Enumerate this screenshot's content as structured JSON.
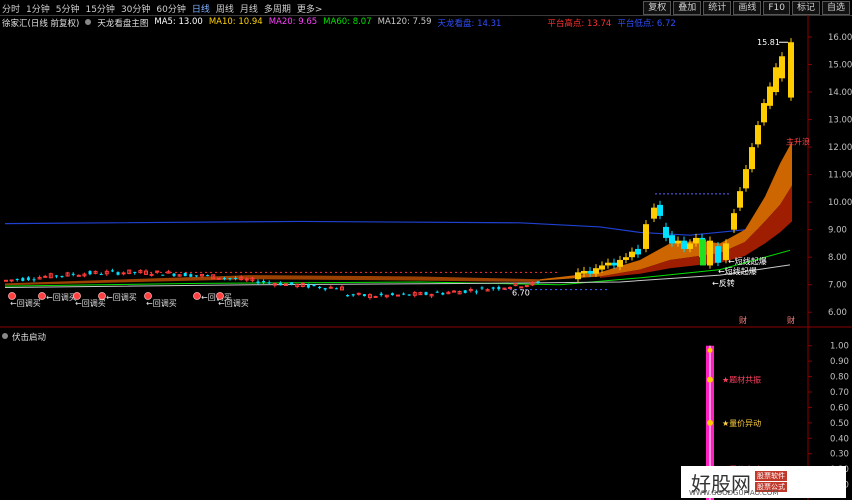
{
  "toolbar": {
    "periods": [
      "分时",
      "1分钟",
      "5分钟",
      "15分钟",
      "30分钟",
      "60分钟",
      "日线",
      "周线",
      "月线",
      "多周期",
      "更多>"
    ],
    "active_period": "日线",
    "tools": [
      "复权",
      "叠加",
      "统计",
      "画线",
      "F10",
      "标记",
      "自选"
    ]
  },
  "indicator_line": {
    "stock": "徐家汇(日线 前复权)",
    "formula": "天龙看盘主图",
    "ma5": "MA5: 13.00",
    "ma10": "MA10: 10.94",
    "ma20": "MA20: 9.65",
    "ma60": "MA60: 8.07",
    "ma120": "MA120: 7.59",
    "extra": "天龙看盘: 14.31",
    "platform_high": "平台高点: 13.74",
    "platform_low": "平台低点: 6.72"
  },
  "sub": {
    "title": "伏击启动"
  },
  "colors": {
    "ma5": "#ffffff",
    "ma10": "#ffd200",
    "ma20": "#ff40ff",
    "ma60": "#00e000",
    "ma120": "#c8c8c8",
    "extra": "#3050ff",
    "platform": "#ff3030",
    "up": "#ffcc00",
    "down": "#00e0ff"
  },
  "chart_data": [
    {
      "type": "candlestick",
      "y_ticks": [
        "16.00",
        "15.00",
        "14.00",
        "13.00",
        "12.00",
        "11.00",
        "10.00",
        "9.00",
        "8.00",
        "7.00",
        "6.00"
      ],
      "ylim": [
        5.5,
        16.4
      ],
      "high_label": "15.81",
      "low_label": "6.70",
      "annotations": [
        "←回调买",
        "←回调买",
        "←回调买",
        "←回调买",
        "←回调买",
        "←回调买",
        "←回调买",
        "主升浪",
        "←短线起爆",
        "←短线起爆",
        "←反转"
      ],
      "markers": [
        "财",
        "财"
      ]
    },
    {
      "type": "bar",
      "y_ticks": [
        "1.00",
        "0.90",
        "0.80",
        "0.70",
        "0.60",
        "0.50",
        "0.40",
        "0.30",
        "0.20",
        "0.10"
      ],
      "ylim": [
        0,
        1.05
      ],
      "labels": [
        "★题材共振",
        "★量价异动",
        "★量价启动"
      ]
    }
  ],
  "watermark": {
    "logo": "好股网",
    "tag1": "股票软件",
    "tag2": "股票公式",
    "url": "WWW.GOODGUPIAO.COM"
  }
}
